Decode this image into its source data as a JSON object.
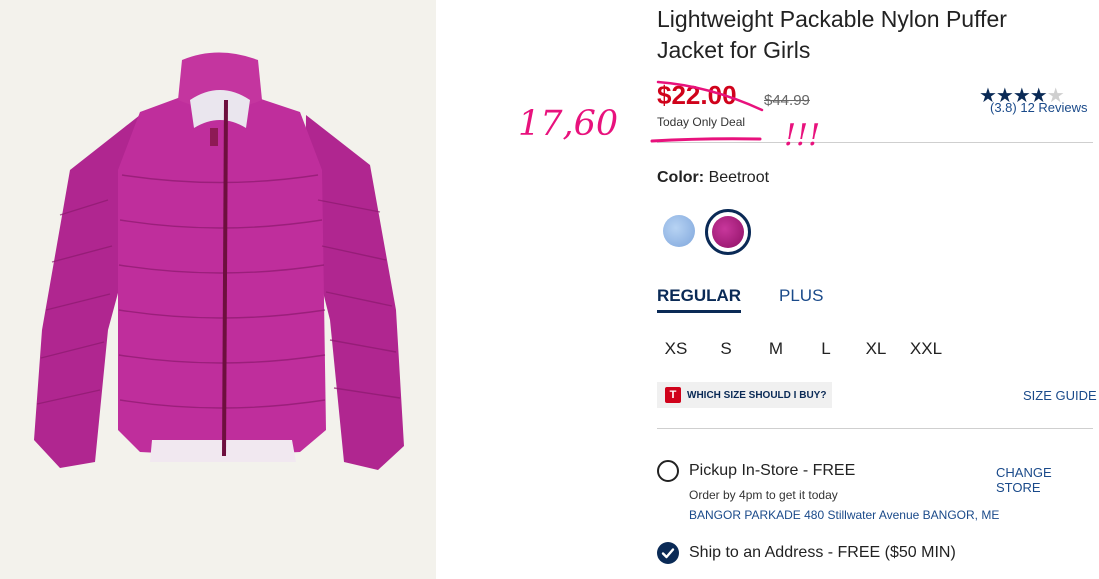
{
  "product": {
    "title": "Lightweight Packable Nylon Puffer Jacket for Girls",
    "sale_price": "$22.00",
    "original_price": "$44.99",
    "deal_label": "Today Only Deal",
    "rating": {
      "value": 3.8,
      "text": "(3.8) 12 Reviews"
    }
  },
  "color": {
    "label": "Color:",
    "selected": "Beetroot",
    "swatches": [
      {
        "icon": "swatch-light-blue",
        "hex": "#9ec0ea",
        "selected": false
      },
      {
        "icon": "swatch-beetroot",
        "hex": "#b0227f",
        "selected": true
      }
    ]
  },
  "fit_tabs": [
    {
      "label": "REGULAR",
      "active": true
    },
    {
      "label": "PLUS",
      "active": false
    }
  ],
  "sizes": [
    "XS",
    "S",
    "M",
    "L",
    "XL",
    "XXL"
  ],
  "size_help": {
    "badge": "T",
    "text": "WHICH SIZE SHOULD I BUY?",
    "guide_link": "SIZE GUIDE"
  },
  "fulfillment": {
    "pickup_label": "Pickup In-Store - FREE",
    "change_store": "CHANGE STORE",
    "pickup_note": "Order by 4pm to get it today",
    "store_address": "BANGOR PARKADE 480 Stillwater Avenue  BANGOR, ME",
    "ship_label": "Ship to an Address - FREE ($50 MIN)",
    "ship_selected": true
  },
  "annotations": {
    "price": "17,60",
    "exclaim": "!!!",
    "color": "#e8127d"
  }
}
